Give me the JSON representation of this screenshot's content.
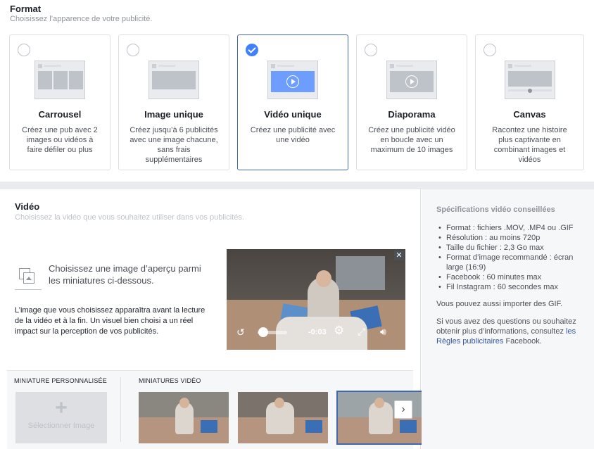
{
  "format": {
    "title": "Format",
    "subtitle": "Choisissez l’apparence de votre publicité.",
    "cards": [
      {
        "title": "Carrousel",
        "desc": "Créez une pub avec 2 images ou vidéos à faire défiler ou plus",
        "selected": false
      },
      {
        "title": "Image unique",
        "desc": "Créez jusqu’à 6 publicités avec une image chacune, sans frais supplémentaires",
        "selected": false
      },
      {
        "title": "Vidéo unique",
        "desc": "Créez une publicité avec une vidéo",
        "selected": true
      },
      {
        "title": "Diaporama",
        "desc": "Créez une publicité vidéo en boucle avec un maximum de 10 images",
        "selected": false
      },
      {
        "title": "Canvas",
        "desc": "Racontez une histoire plus captivante en combinant images et vidéos",
        "selected": false
      }
    ]
  },
  "video": {
    "title": "Vidéo",
    "subtitle": "Choisissez la vidéo que vous souhaitez utiliser dans vos publicités.",
    "pick_text": "Choisissez une image d’aperçu parmi les miniatures ci-dessous.",
    "pick_help": "L’image que vous choisissez apparaîtra avant la lecture de la vidéo et à la fin. Un visuel bien choisi a un réel impact sur la perception de vos publicités.",
    "player": {
      "time": "-0:03",
      "close": "✕",
      "progress": 0.08
    },
    "thumbs": {
      "custom_label": "MINIATURE PERSONNALISÉE",
      "custom_button": "Sélectionner Image",
      "video_label": "MINIATURES VIDÉO",
      "selected_index": 2
    }
  },
  "spec": {
    "title": "Spécifications vidéo conseillées",
    "items": [
      "Format : fichiers .MOV, .MP4 ou .GIF",
      "Résolution : au moins 720p",
      "Taille du fichier : 2,3 Go max",
      "Format d’image recommandé : écran large (16:9)",
      "Facebook : 60 minutes max",
      "Fil Instagram : 60 secondes max"
    ],
    "gif_note": "Vous pouvez aussi importer des GIF.",
    "more_before": "Si vous avez des questions ou souhaitez obtenir plus d’informations, consultez ",
    "more_link": "les Règles publicitaires",
    "more_after": " Facebook."
  },
  "colors": {
    "accent": "#4267b2",
    "check": "#4080ff",
    "link": "#365899"
  }
}
